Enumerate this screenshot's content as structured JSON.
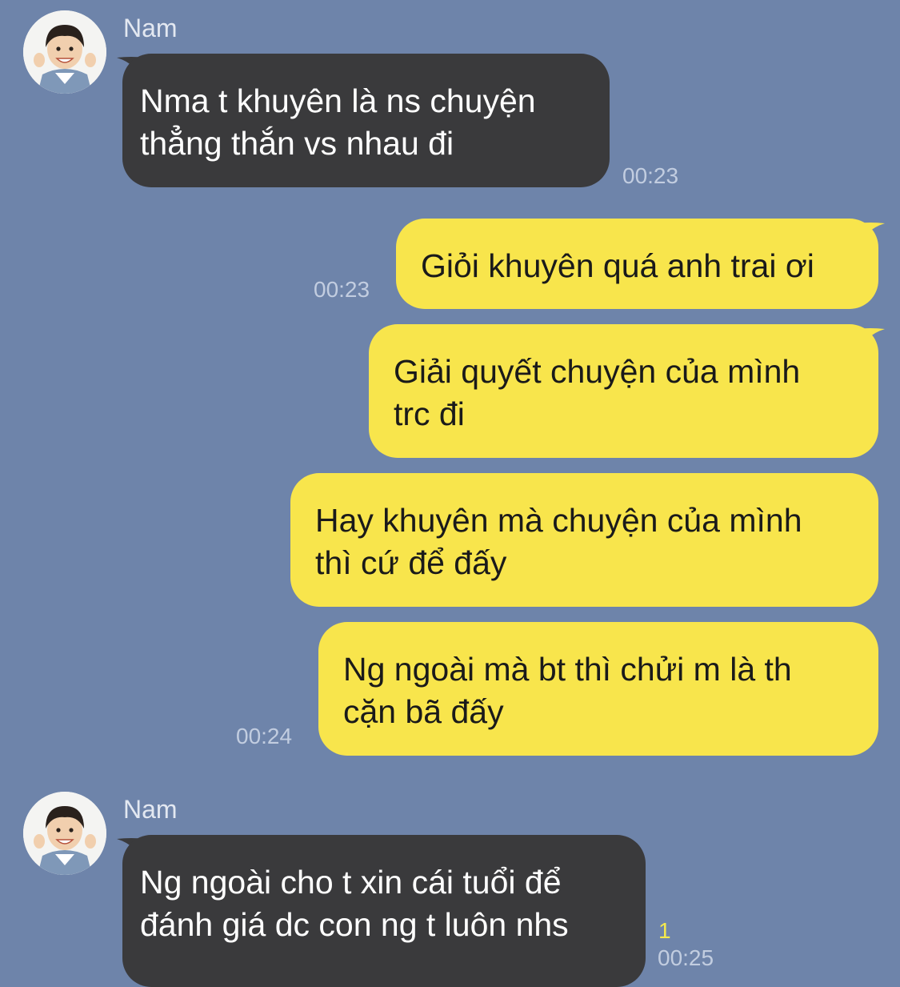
{
  "chat": {
    "contact_name": "Nam",
    "avatar_icon": "child-portrait-icon",
    "colors": {
      "background": "#6e84aa",
      "incoming_bubble": "#3a3a3c",
      "outgoing_bubble": "#f8e54c",
      "read_count": "#f5e94c"
    },
    "messages": [
      {
        "direction": "incoming",
        "sender": "Nam",
        "text": "Nma t khuyên là ns chuyện\nthẳng thắn vs nhau đi",
        "time": "00:23"
      },
      {
        "direction": "outgoing",
        "text": "Giỏi khuyên quá anh trai ơi",
        "time": "00:23"
      },
      {
        "direction": "outgoing",
        "text": "Giải quyết chuyện của mình\ntrc đi"
      },
      {
        "direction": "outgoing",
        "text": "Hay khuyên mà chuyện của mình\nthì cứ để đấy"
      },
      {
        "direction": "outgoing",
        "text": "Ng ngoài mà bt thì chửi m là th\ncặn bã đấy",
        "time": "00:24"
      },
      {
        "direction": "incoming",
        "sender": "Nam",
        "text": "Ng ngoài cho t xin cái tuổi để\nđánh giá dc con ng t luôn nhs",
        "time": "00:25",
        "read_count": "1"
      }
    ]
  }
}
